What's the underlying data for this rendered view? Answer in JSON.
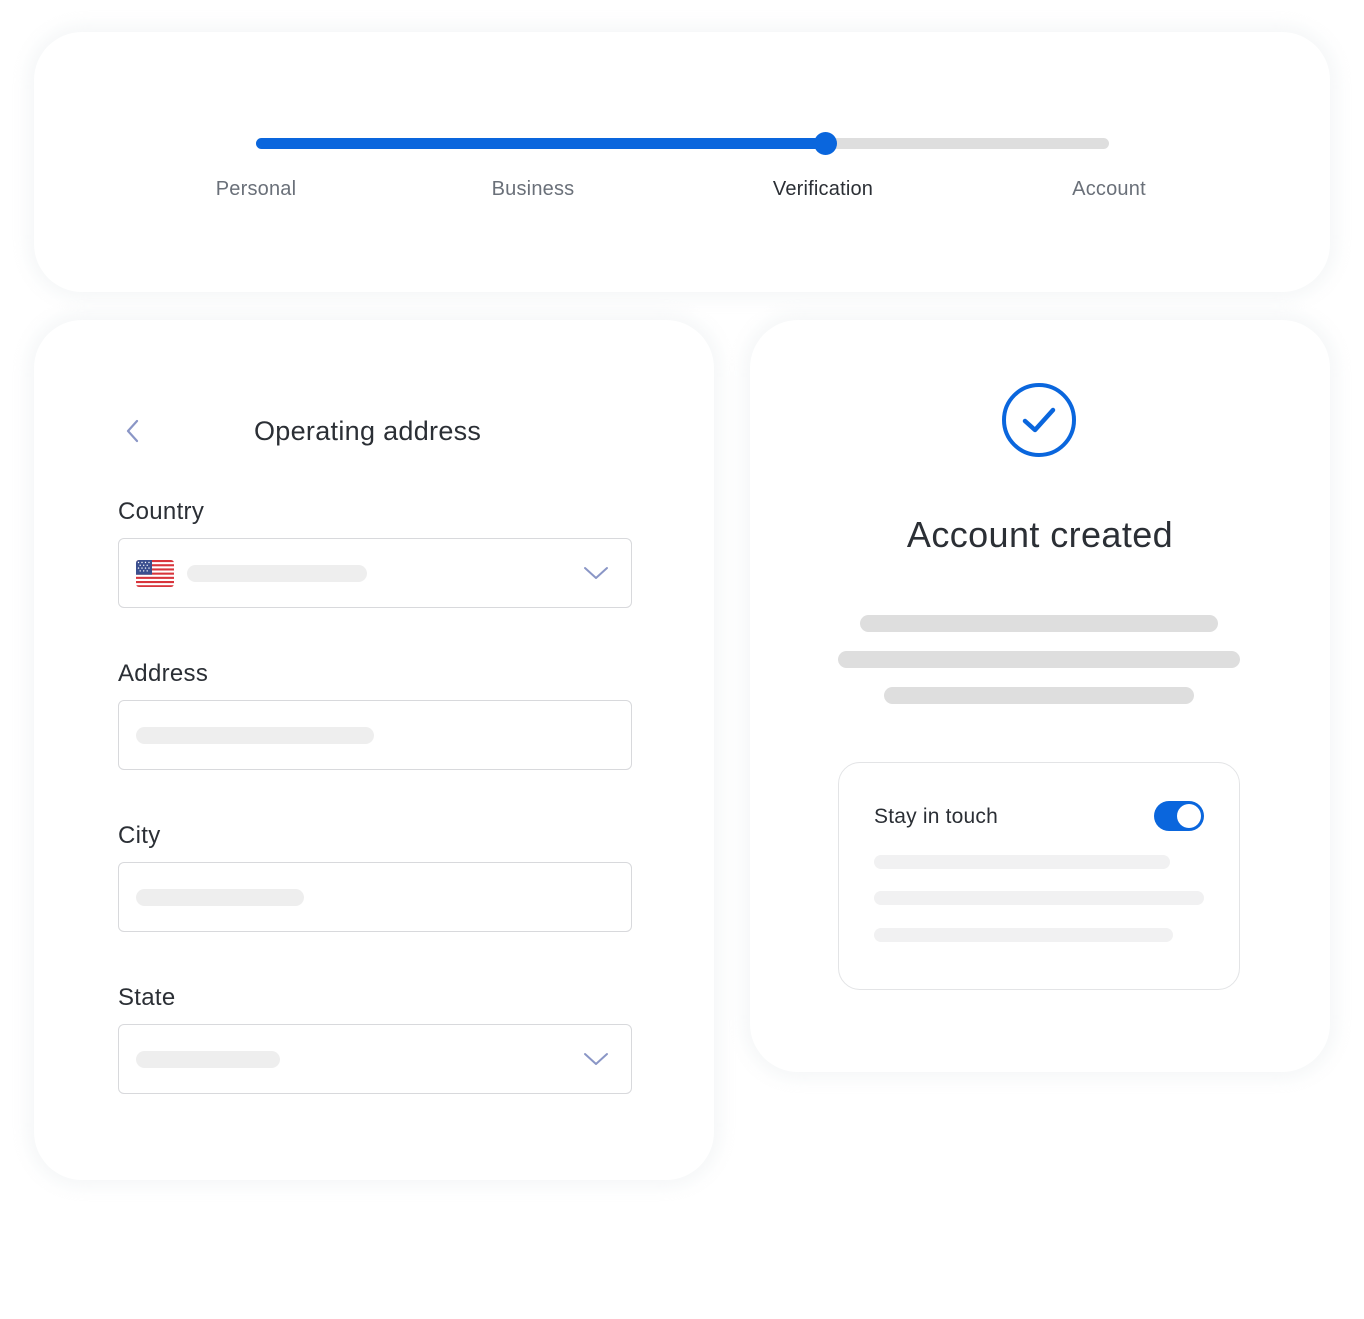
{
  "stepper": {
    "steps": [
      {
        "label": "Personal",
        "state": "done"
      },
      {
        "label": "Business",
        "state": "done"
      },
      {
        "label": "Verification",
        "state": "current"
      },
      {
        "label": "Account",
        "state": "upcoming"
      }
    ],
    "progress_fraction": 0.667,
    "accent_color": "#0a66dd"
  },
  "address_form": {
    "back_icon": "chevron-left-icon",
    "title": "Operating address",
    "fields": {
      "country": {
        "label": "Country",
        "flag": "us-flag-icon",
        "control": "select"
      },
      "address": {
        "label": "Address",
        "control": "text"
      },
      "city": {
        "label": "City",
        "control": "text"
      },
      "state": {
        "label": "State",
        "control": "select"
      }
    }
  },
  "success": {
    "icon": "check-circle-icon",
    "title": "Account created",
    "stay_in_touch": {
      "label": "Stay in touch",
      "toggle_on": true
    }
  }
}
